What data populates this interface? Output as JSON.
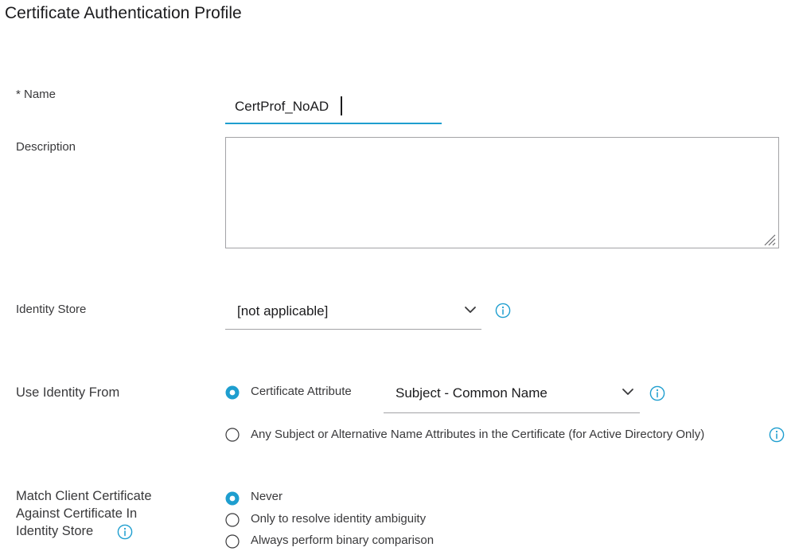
{
  "page": {
    "title": "Certificate Authentication Profile"
  },
  "name_field": {
    "label": "* Name",
    "value": "CertProf_NoAD"
  },
  "description_field": {
    "label": "Description",
    "value": ""
  },
  "identity_store": {
    "label": "Identity Store",
    "selected": "[not applicable]",
    "icons": [
      "chevron-down-icon",
      "info-icon"
    ]
  },
  "use_identity_from": {
    "label": "Use Identity From",
    "options": [
      {
        "label": "Certificate Attribute",
        "selected": true
      },
      {
        "label": "Any Subject or Alternative Name Attributes in the Certificate (for Active Directory Only)",
        "selected": false
      }
    ],
    "attribute_select": {
      "selected": "Subject - Common Name"
    }
  },
  "match_client_certificate": {
    "label_lines": [
      "Match Client Certificate",
      "Against Certificate In",
      "Identity Store"
    ],
    "options": [
      {
        "label": "Never",
        "selected": true
      },
      {
        "label": "Only to resolve identity ambiguity",
        "selected": false
      },
      {
        "label": "Always perform binary comparison",
        "selected": false
      }
    ]
  },
  "colors": {
    "accent": "#1e9ecf",
    "text": "#39393b",
    "title": "#1b1b1d",
    "border": "#a3a3a6"
  }
}
